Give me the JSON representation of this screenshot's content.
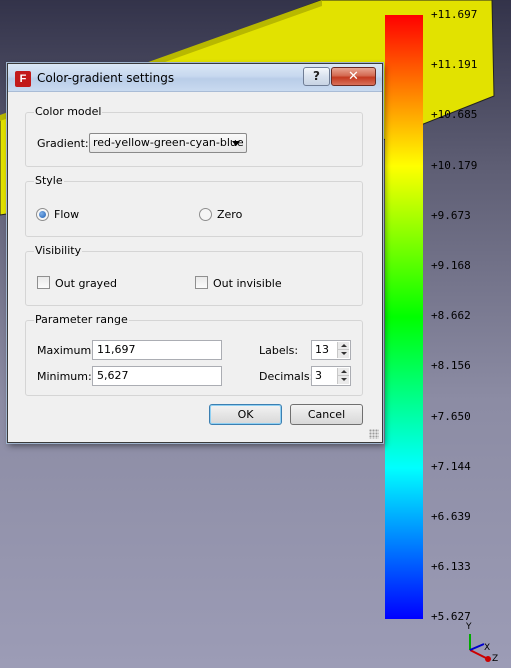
{
  "dialog": {
    "title": "Color-gradient settings",
    "app_icon": "freecad-icon",
    "help_label": "?",
    "close_label": "✕",
    "color_model": {
      "title": "Color model",
      "gradient_label": "Gradient:",
      "gradient_value": "red-yellow-green-cyan-blue"
    },
    "style": {
      "title": "Style",
      "flow_label": "Flow",
      "zero_label": "Zero",
      "selected": "Flow"
    },
    "visibility": {
      "title": "Visibility",
      "out_grayed_label": "Out grayed",
      "out_invisible_label": "Out invisible",
      "out_grayed_checked": false,
      "out_invisible_checked": false
    },
    "parameter_range": {
      "title": "Parameter range",
      "maximum_label": "Maximum:",
      "maximum_value": "11,697",
      "minimum_label": "Minimum:",
      "minimum_value": "5,627",
      "labels_label": "Labels:",
      "labels_value": "13",
      "decimals_label": "Decimals:",
      "decimals_value": "3"
    },
    "ok_label": "OK",
    "cancel_label": "Cancel"
  },
  "legend": {
    "colors": [
      "#ff0000",
      "#ffff00",
      "#00ff00",
      "#00ffff",
      "#0000ff"
    ],
    "labels": [
      "+11.697",
      "+11.191",
      "+10.685",
      "+10.179",
      "+9.673",
      "+9.168",
      "+8.662",
      "+8.156",
      "+7.650",
      "+7.144",
      "+6.639",
      "+6.133",
      "+5.627"
    ]
  },
  "triad": {
    "y_label": "Y",
    "x_label": "X",
    "z_label": "Z"
  },
  "colors": {
    "object": "#e6e600",
    "background_top": "#33334a",
    "background_bottom": "#9c9cb6"
  }
}
